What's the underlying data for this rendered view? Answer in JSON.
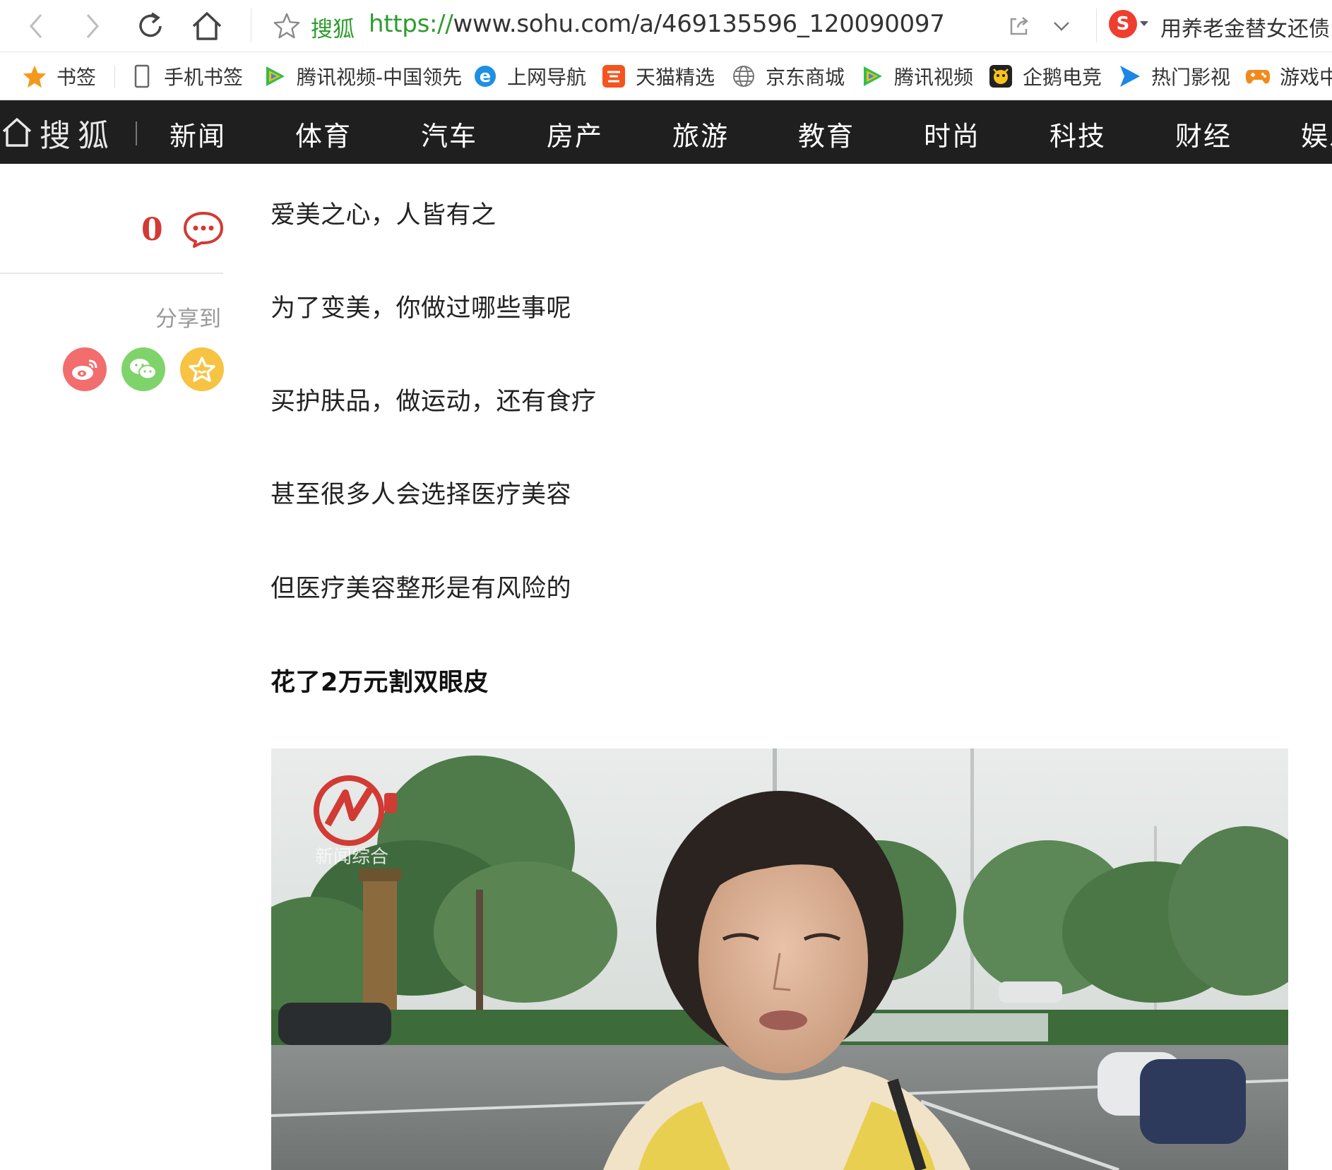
{
  "browser": {
    "site_label": "搜狐",
    "url_scheme": "https://",
    "url_rest": "www.sohu.com/a/469135596_120090097",
    "search_hint": "用养老金替女还债"
  },
  "bookmarks": [
    {
      "label": "书签",
      "icon": "star-icon"
    },
    {
      "label": "手机书签",
      "icon": "phone-icon"
    },
    {
      "label": "腾讯视频-中国领先",
      "icon": "tencent-video-icon"
    },
    {
      "label": "上网导航",
      "icon": "ie-icon"
    },
    {
      "label": "天猫精选",
      "icon": "taobao-icon"
    },
    {
      "label": "京东商城",
      "icon": "globe-icon"
    },
    {
      "label": "腾讯视频",
      "icon": "tencent-video-icon"
    },
    {
      "label": "企鹅电竞",
      "icon": "penguin-esports-icon"
    },
    {
      "label": "热门影视",
      "icon": "play-icon"
    },
    {
      "label": "游戏中",
      "icon": "gamepad-icon"
    }
  ],
  "sohu_nav": {
    "logo": "搜狐",
    "channels": [
      "新闻",
      "体育",
      "汽车",
      "房产",
      "旅游",
      "教育",
      "时尚",
      "科技",
      "财经",
      "娱乐"
    ]
  },
  "rail": {
    "comment_count": "0",
    "share_label": "分享到"
  },
  "article": {
    "paragraphs": [
      "爱美之心，人皆有之",
      "为了变美，你做过哪些事呢",
      "买护肤品，做运动，还有食疗",
      "甚至很多人会选择医疗美容",
      "但医疗美容整形是有风险的"
    ],
    "heading": "花了2万元割双眼皮",
    "image_watermark": "新闻综合"
  },
  "colors": {
    "nav_bg": "#1f1f1f",
    "accent_red": "#d23a34",
    "url_green": "#2e9c2e",
    "weibo": "#f26d6d",
    "wechat": "#7fd36b",
    "favorite": "#f7c342"
  }
}
